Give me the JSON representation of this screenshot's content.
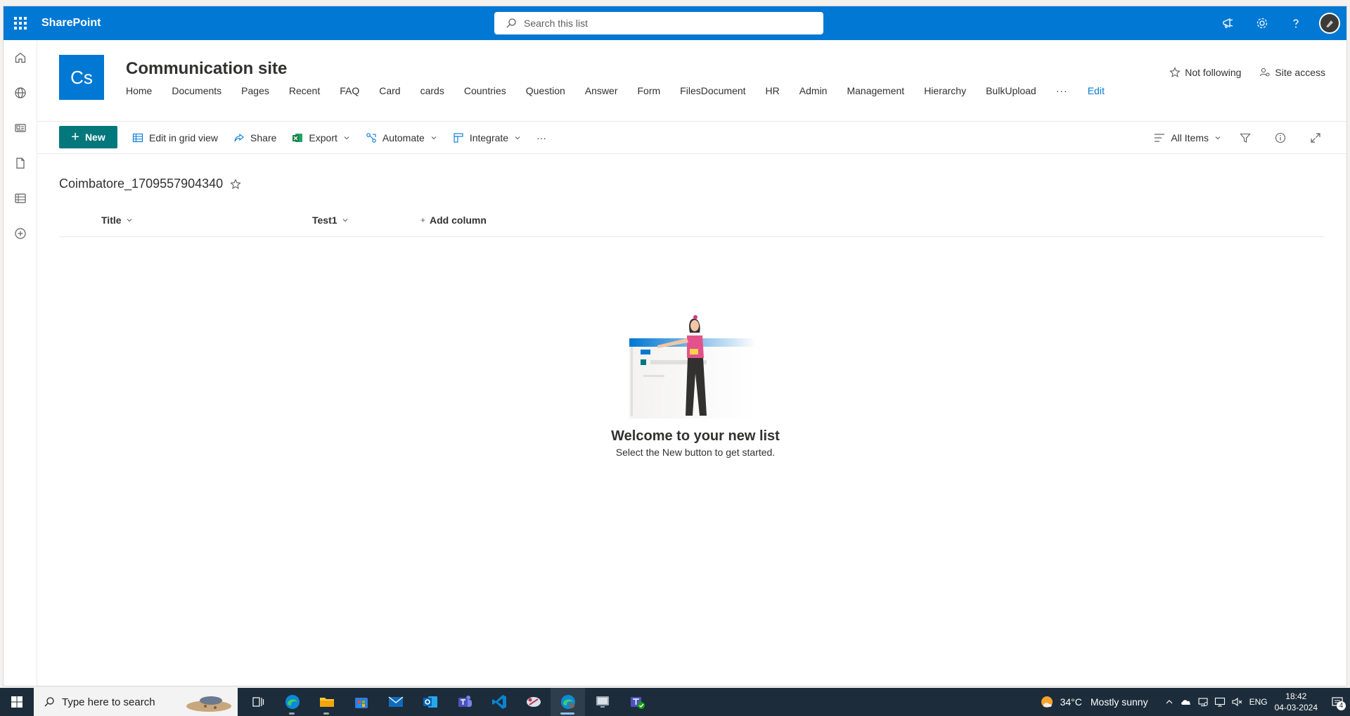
{
  "suitebar": {
    "brand": "SharePoint",
    "search_placeholder": "Search this list",
    "accent": "#0078d4"
  },
  "site": {
    "logo_text": "Cs",
    "title": "Communication site",
    "nav": [
      "Home",
      "Documents",
      "Pages",
      "Recent",
      "FAQ",
      "Card",
      "cards",
      "Countries",
      "Question",
      "Answer",
      "Form",
      "FilesDocument",
      "HR",
      "Admin",
      "Management",
      "Hierarchy",
      "BulkUpload"
    ],
    "nav_more": "···",
    "nav_edit": "Edit",
    "actions": {
      "follow": "Not following",
      "site_access": "Site access"
    }
  },
  "commandbar": {
    "new_label": "New",
    "new_color": "#03787c",
    "edit_grid": "Edit in grid view",
    "share": "Share",
    "export": "Export",
    "automate": "Automate",
    "integrate": "Integrate",
    "more": "···",
    "view": "All Items"
  },
  "list": {
    "name": "Coimbatore_1709557904340",
    "columns": [
      "Title",
      "Test1"
    ],
    "add_column": "Add column",
    "empty_title": "Welcome to your new list",
    "empty_subtitle": "Select the New button to get started."
  },
  "taskbar": {
    "search_placeholder": "Type here to search",
    "weather_temp": "34°C",
    "weather_condition": "Mostly sunny",
    "language": "ENG",
    "time": "18:42",
    "date": "04-03-2024",
    "notifications": "4"
  }
}
